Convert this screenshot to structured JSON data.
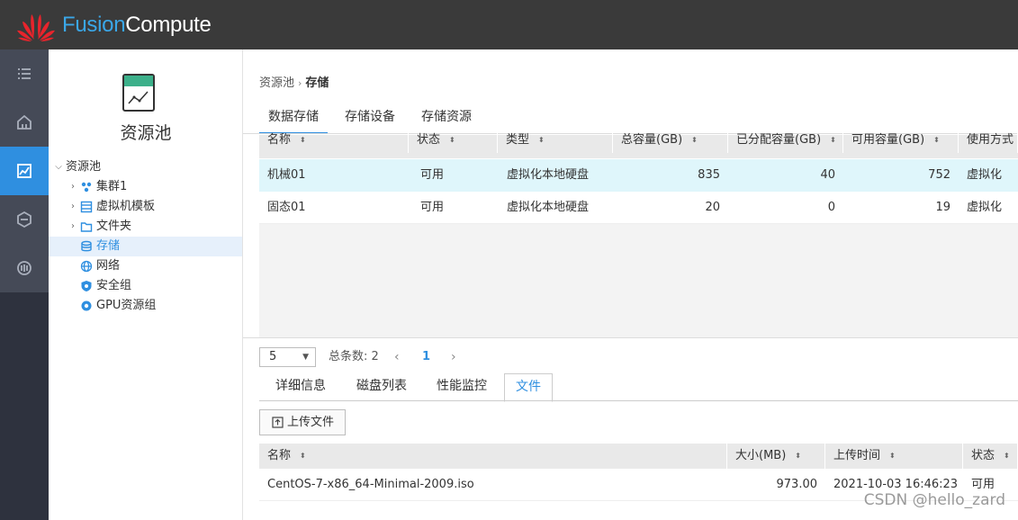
{
  "header": {
    "brand_part1": "Fusion",
    "brand_part2": "Compute",
    "brand_color": "#3aa7e8"
  },
  "rail": {
    "items": [
      {
        "icon": "list-icon",
        "active": false
      },
      {
        "icon": "home-icon",
        "active": false
      },
      {
        "icon": "resource-pool-icon",
        "active": true
      },
      {
        "icon": "network-icon",
        "active": false
      },
      {
        "icon": "monitor-icon",
        "active": false
      }
    ],
    "active_color": "#2f8fe0"
  },
  "tree_panel": {
    "title": "资源池",
    "icon": "resource-pool-chart-icon",
    "nodes": [
      {
        "label": "资源池",
        "expanded": true,
        "icon": "",
        "selected": false
      },
      {
        "label": "集群1",
        "expanded": false,
        "icon": "cluster-icon",
        "selected": false
      },
      {
        "label": "虚拟机模板",
        "expanded": false,
        "icon": "template-icon",
        "selected": false
      },
      {
        "label": "文件夹",
        "expanded": false,
        "icon": "folder-icon",
        "selected": false
      },
      {
        "label": "存储",
        "icon": "storage-icon",
        "selected": true
      },
      {
        "label": "网络",
        "icon": "globe-icon",
        "selected": false
      },
      {
        "label": "安全组",
        "icon": "shield-icon",
        "selected": false
      },
      {
        "label": "GPU资源组",
        "icon": "gear-icon",
        "selected": false
      }
    ]
  },
  "breadcrumb": {
    "parent": "资源池",
    "separator": "›",
    "current": "存储"
  },
  "tabs": [
    {
      "label": "数据存储",
      "active": true
    },
    {
      "label": "存储设备",
      "active": false
    },
    {
      "label": "存储资源",
      "active": false
    }
  ],
  "datastore_table": {
    "columns": [
      "名称",
      "状态",
      "类型",
      "总容量(GB)",
      "已分配容量(GB)",
      "可用容量(GB)",
      "使用方式"
    ],
    "rows": [
      [
        "机械01",
        "可用",
        "虚拟化本地硬盘",
        "835",
        "40",
        "752",
        "虚拟化"
      ],
      [
        "固态01",
        "可用",
        "虚拟化本地硬盘",
        "20",
        "0",
        "19",
        "虚拟化"
      ]
    ]
  },
  "pager": {
    "page_size": "5",
    "total": "总条数: 2",
    "prev": "‹",
    "current_page": "1",
    "next": "›"
  },
  "detail_tabs": [
    {
      "label": "详细信息",
      "active": false
    },
    {
      "label": "磁盘列表",
      "active": false
    },
    {
      "label": "性能监控",
      "active": false
    },
    {
      "label": "文件",
      "active": true
    }
  ],
  "upload_button": "上传文件",
  "file_table": {
    "columns": [
      "名称",
      "大小(MB)",
      "上传时间",
      "状态"
    ],
    "rows": [
      [
        "CentOS-7-x86_64-Minimal-2009.iso",
        "973.00",
        "2021-10-03 16:46:23",
        "可用"
      ]
    ]
  },
  "sort_glyph": "⬍",
  "watermark": "CSDN @hello_zard"
}
